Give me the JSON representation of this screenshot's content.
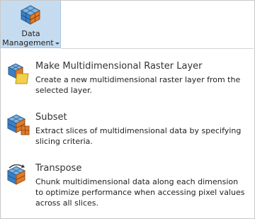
{
  "ribbon": {
    "button_label_line1": "Data",
    "button_label_line2": "Management",
    "icon": "multidimensional-cube-icon"
  },
  "menu": {
    "items": [
      {
        "title": "Make Multidimensional Raster Layer",
        "description": "Create a new multidimensional raster layer from the selected layer.",
        "icon": "make-multidimensional-layer-icon"
      },
      {
        "title": "Subset",
        "description": "Extract slices of multidimensional data by specifying slicing criteria.",
        "icon": "subset-icon"
      },
      {
        "title": "Transpose",
        "description": "Chunk multidimensional data along each dimension to optimize performance when accessing pixel values across all slices.",
        "icon": "transpose-icon"
      }
    ]
  },
  "colors": {
    "ribbon_hover": "#c5dcf0",
    "cube_blue": "#3a7fc4",
    "cube_orange": "#e07b2a",
    "layer_yellow": "#f2d04b"
  }
}
